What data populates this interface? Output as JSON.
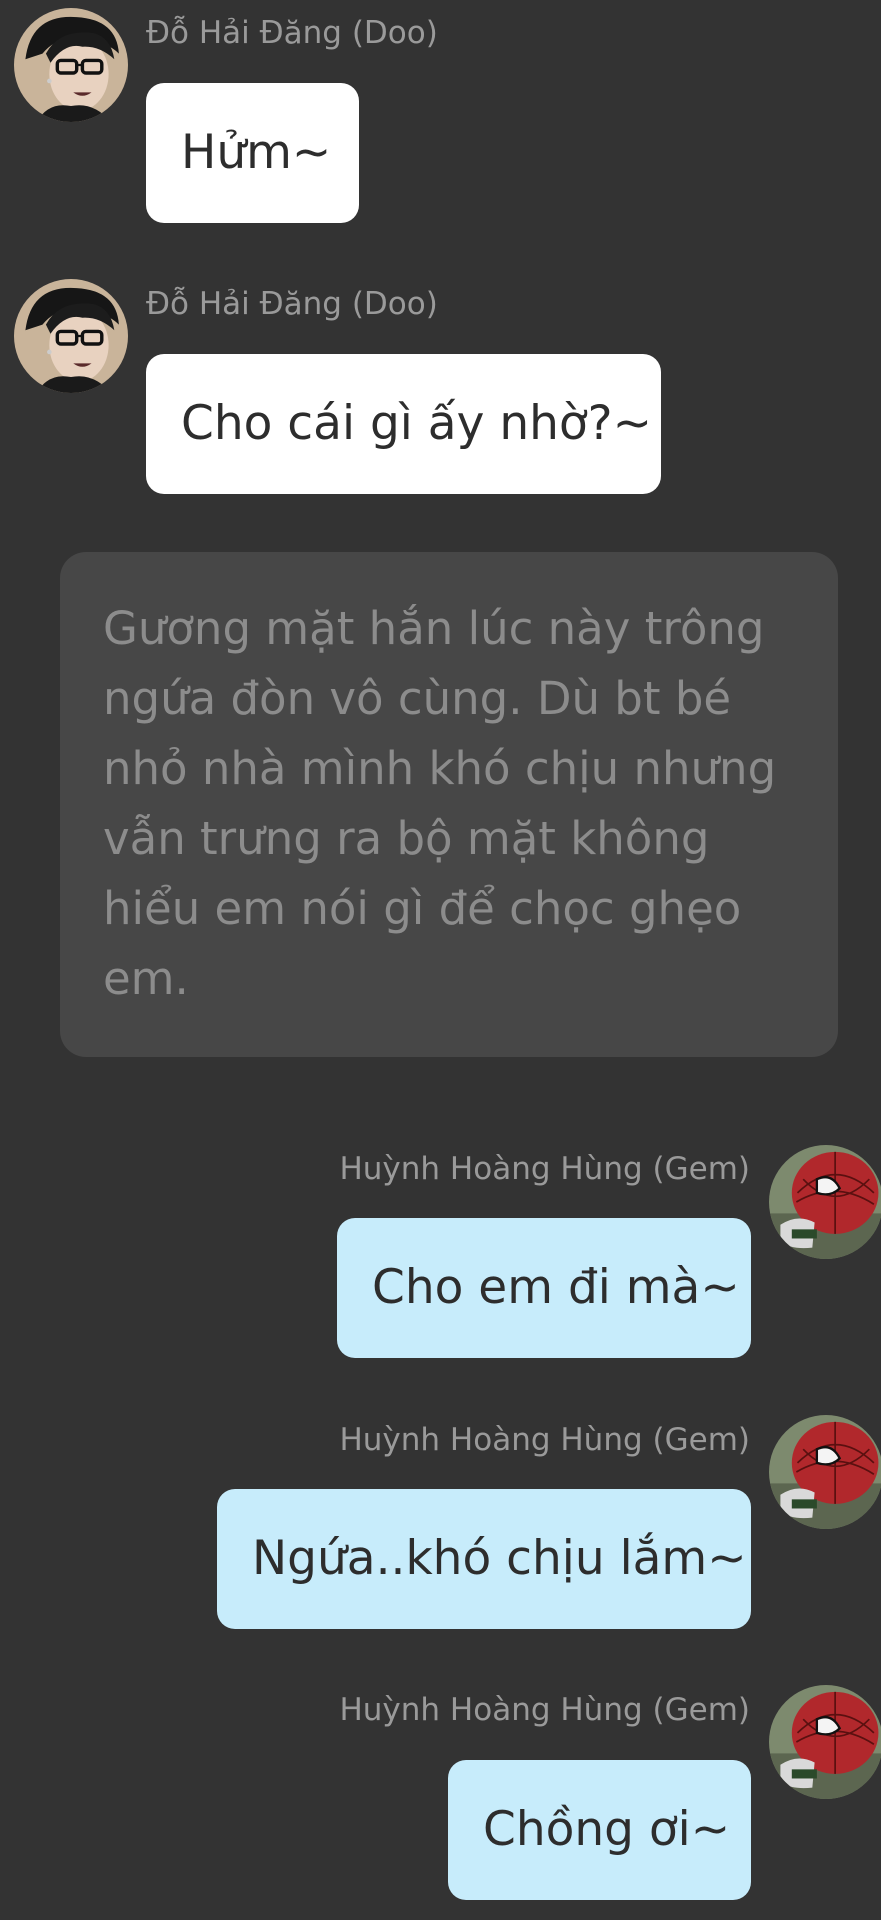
{
  "colors": {
    "background": "#333333",
    "left_bubble": "#ffffff",
    "right_bubble": "#c7ecfb",
    "narration_box": "#474747",
    "name_text": "#9a9a9a",
    "narration_text": "#8c8c8c"
  },
  "messages": [
    {
      "sender": "Đỗ Hải Đăng (Doo)",
      "text": "Hửm~",
      "side": "left",
      "avatar": "doo-avatar"
    },
    {
      "sender": "Đỗ Hải Đăng (Doo)",
      "text": "Cho cái gì ấy nhờ?~",
      "side": "left",
      "avatar": "doo-avatar"
    }
  ],
  "narration": {
    "text": "Gương mặt hắn lúc này trông ngứa đòn vô cùng. Dù bt bé nhỏ nhà mình khó chịu nhưng vẫn trưng ra bộ mặt không hiểu em nói gì để chọc ghẹo em."
  },
  "replies": [
    {
      "sender": "Huỳnh Hoàng Hùng (Gem)",
      "text": "Cho em đi mà~",
      "side": "right",
      "avatar": "gem-avatar"
    },
    {
      "sender": "Huỳnh Hoàng Hùng (Gem)",
      "text": "Ngứa..khó chịu lắm~",
      "side": "right",
      "avatar": "gem-avatar"
    },
    {
      "sender": "Huỳnh Hoàng Hùng (Gem)",
      "text": "Chồng ơi~",
      "side": "right",
      "avatar": "gem-avatar"
    }
  ]
}
